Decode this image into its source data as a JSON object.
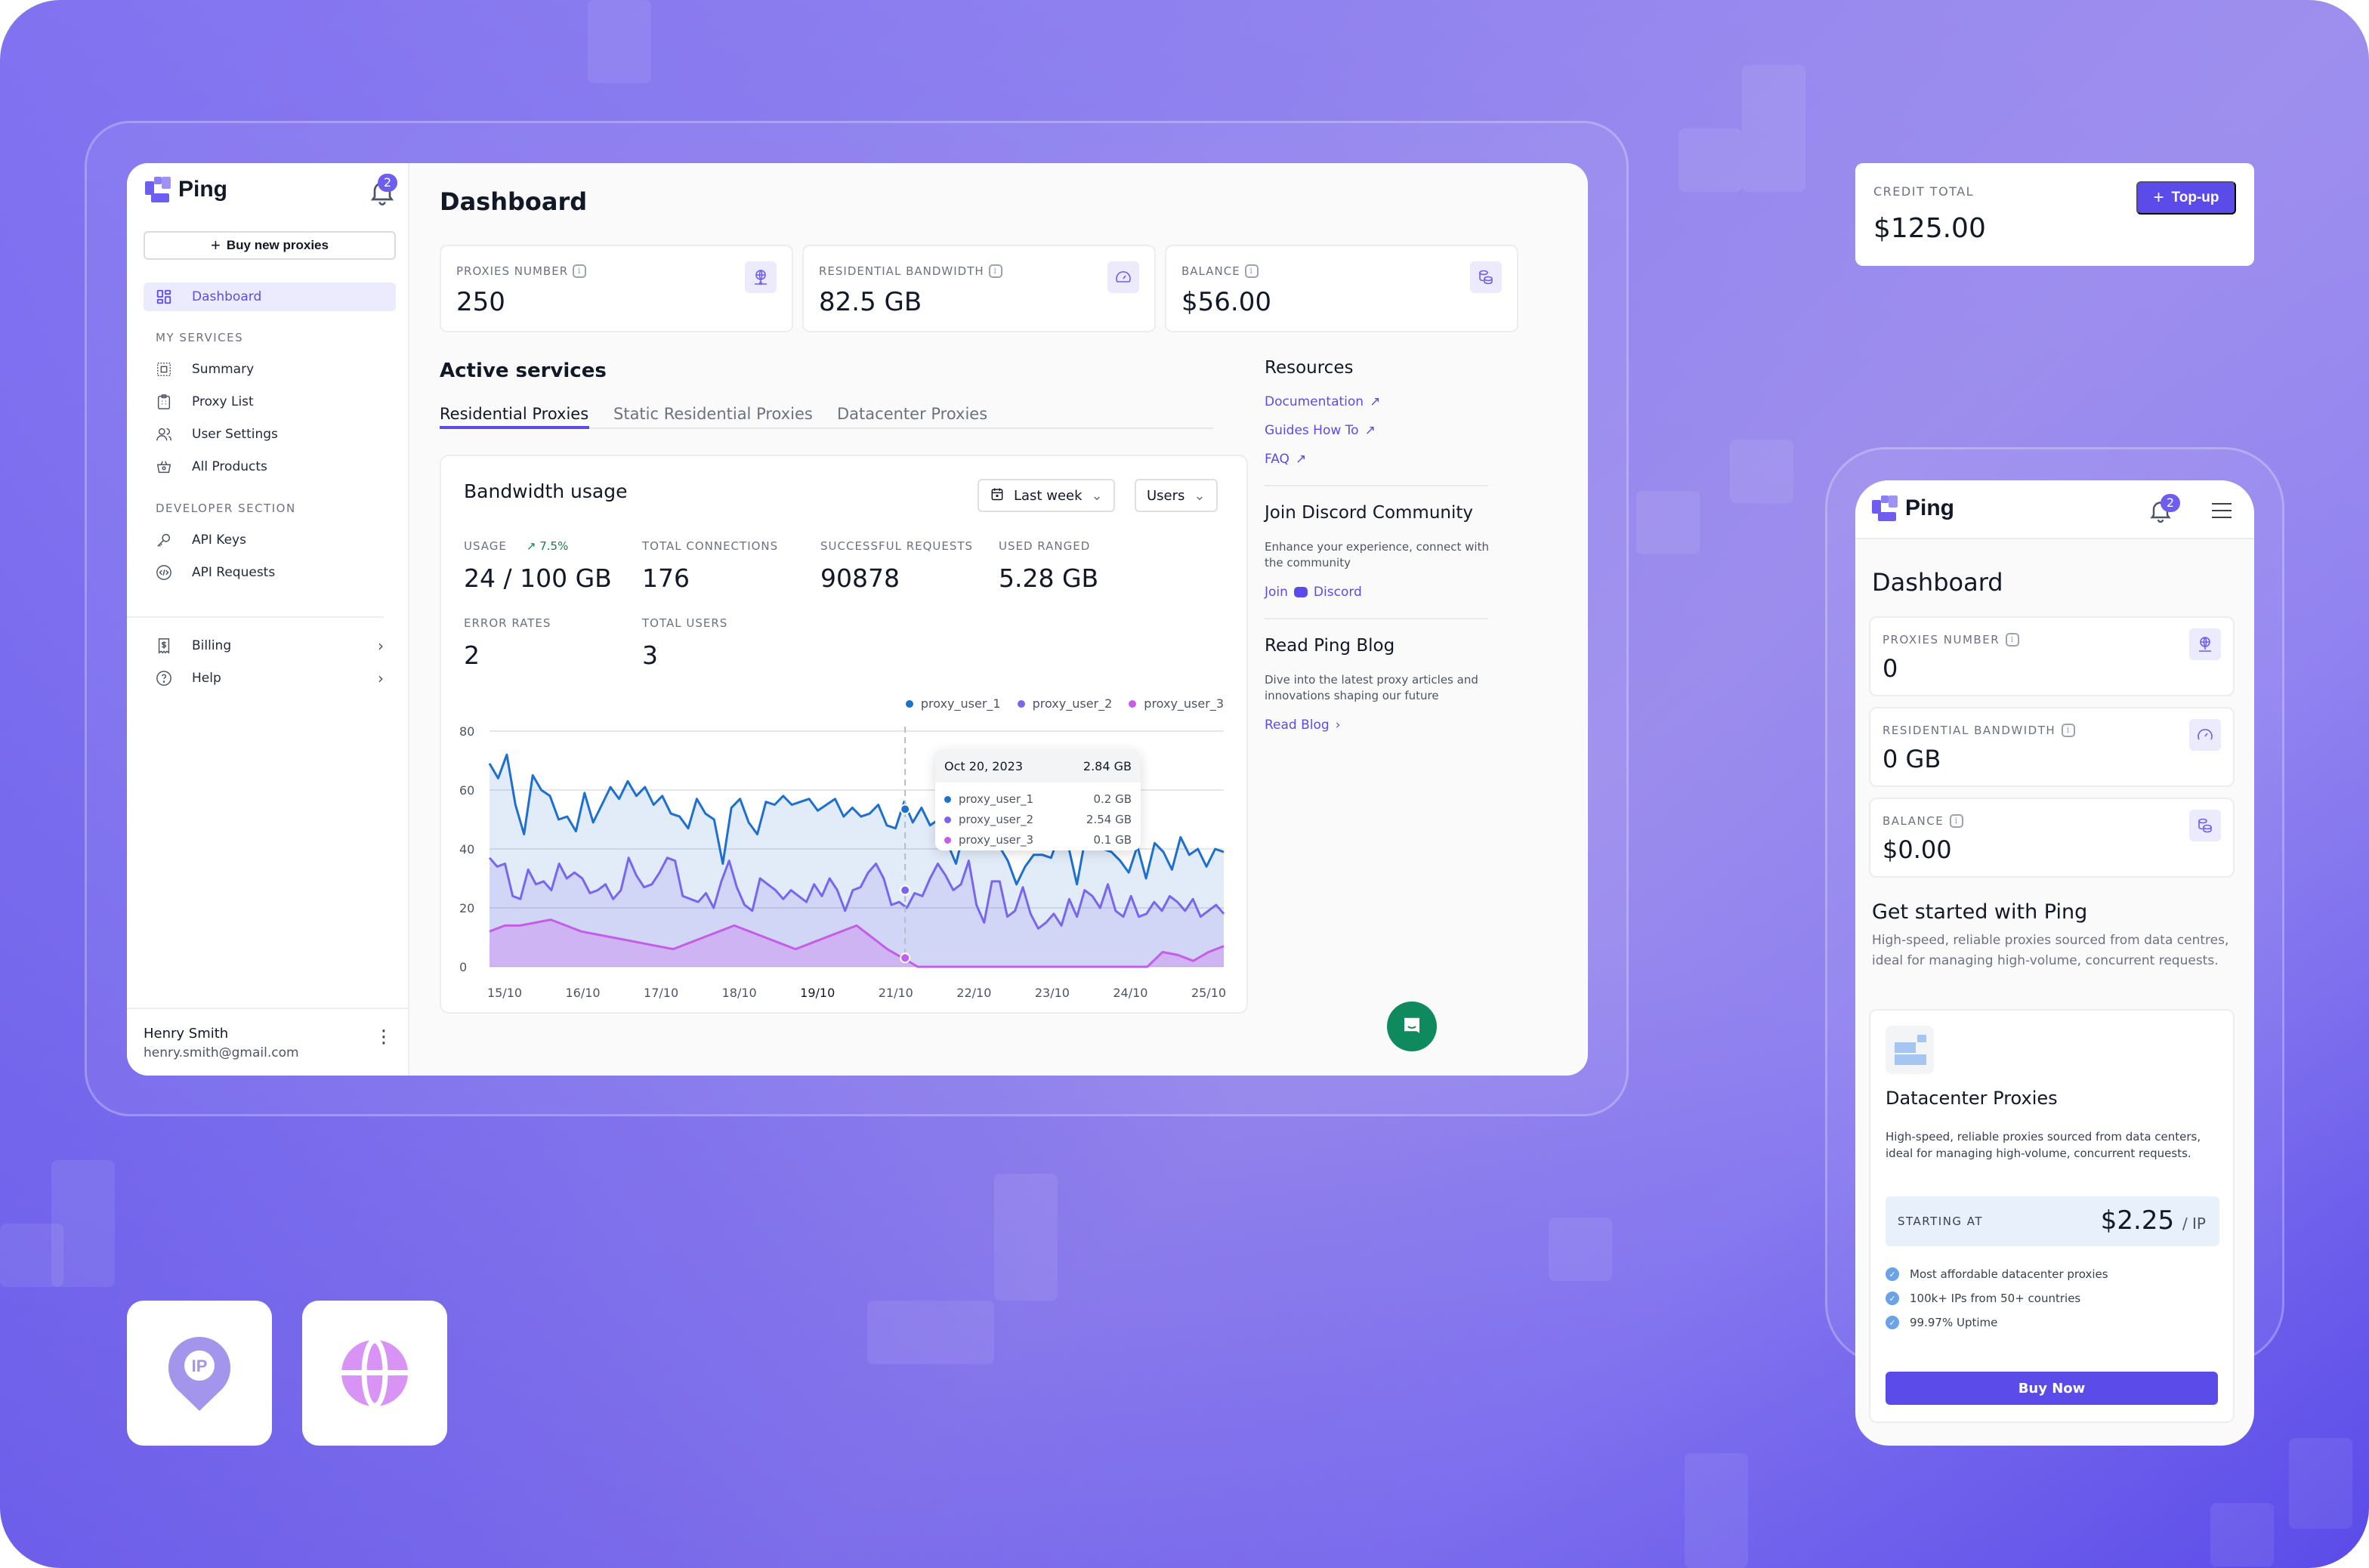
{
  "brand": {
    "name": "Ping",
    "accent": "#5b4ce9",
    "notifications": "2"
  },
  "sidebar": {
    "buy_button": "Buy new proxies",
    "items_top": [
      {
        "label": "Dashboard",
        "icon": "dashboard-grid-icon",
        "active": true
      }
    ],
    "section_services": "MY SERVICES",
    "services": [
      {
        "label": "Summary",
        "icon": "summary-icon"
      },
      {
        "label": "Proxy List",
        "icon": "clipboard-icon"
      },
      {
        "label": "User Settings",
        "icon": "users-icon"
      },
      {
        "label": "All Products",
        "icon": "basket-icon"
      }
    ],
    "section_developer": "DEVELOPER SECTION",
    "developer": [
      {
        "label": "API Keys",
        "icon": "key-icon"
      },
      {
        "label": "API Requests",
        "icon": "code-icon"
      }
    ],
    "bottom": [
      {
        "label": "Billing",
        "icon": "receipt-icon"
      },
      {
        "label": "Help",
        "icon": "help-icon"
      }
    ],
    "user": {
      "name": "Henry Smith",
      "email": "henry.smith@gmail.com"
    }
  },
  "main": {
    "title": "Dashboard",
    "stats": [
      {
        "label": "PROXIES NUMBER",
        "value": "250",
        "icon": "globe-network-icon"
      },
      {
        "label": "RESIDENTIAL BANDWIDTH",
        "value": "82.5 GB",
        "icon": "speedometer-icon"
      },
      {
        "label": "BALANCE",
        "value": "$56.00",
        "icon": "coins-icon"
      }
    ],
    "active_services": "Active services",
    "tabs": [
      {
        "label": "Residential Proxies",
        "active": true
      },
      {
        "label": "Static Residential Proxies"
      },
      {
        "label": "Datacenter Proxies"
      }
    ],
    "bandwidth": {
      "title": "Bandwidth usage",
      "period": "Last week",
      "group_by": "Users",
      "metrics": [
        {
          "label": "USAGE",
          "value": "24 / 100 GB",
          "trend": "7.5%"
        },
        {
          "label": "TOTAL CONNECTIONS",
          "value": "176"
        },
        {
          "label": "SUCCESSFUL REQUESTS",
          "value": "90878"
        },
        {
          "label": "USED RANGED",
          "value": "5.28 GB"
        },
        {
          "label": "ERROR RATES",
          "value": "2"
        },
        {
          "label": "TOTAL USERS",
          "value": "3"
        }
      ],
      "tooltip": {
        "date": "Oct 20, 2023",
        "total": "2.84 GB",
        "rows": [
          {
            "name": "proxy_user_1",
            "value": "0.2 GB"
          },
          {
            "name": "proxy_user_2",
            "value": "2.54 GB"
          },
          {
            "name": "proxy_user_3",
            "value": "0.1 GB"
          }
        ]
      }
    }
  },
  "chart_data": {
    "type": "area",
    "title": "Bandwidth usage",
    "xlabel": "",
    "ylabel": "",
    "ylim": [
      0,
      80
    ],
    "yticks": [
      0,
      20,
      40,
      60,
      80
    ],
    "categories": [
      "15/10",
      "16/10",
      "17/10",
      "18/10",
      "19/10",
      "21/10",
      "22/10",
      "23/10",
      "24/10",
      "25/10"
    ],
    "legend": "top-right",
    "grid": true,
    "series": [
      {
        "name": "proxy_user_1",
        "color": "#1d6fd0",
        "values": [
          69,
          64,
          72,
          55,
          45,
          65,
          60,
          58,
          50,
          51,
          46,
          59,
          49,
          55,
          61,
          57,
          63,
          58,
          61,
          55,
          58,
          52,
          51,
          47,
          57,
          52,
          50,
          35,
          54,
          57,
          49,
          45,
          56,
          55,
          58,
          55,
          56,
          57,
          53,
          55,
          57,
          51,
          54,
          51,
          52,
          55,
          48,
          47,
          56,
          49,
          54,
          48,
          50,
          42,
          35,
          47,
          52,
          52,
          51,
          41,
          36,
          28,
          34,
          38,
          38,
          37,
          45,
          41,
          28,
          44,
          42,
          40,
          39,
          36,
          32,
          41,
          30,
          42,
          39,
          33,
          44,
          38,
          40,
          34,
          40,
          39
        ]
      },
      {
        "name": "proxy_user_2",
        "color": "#7a66ee",
        "values": [
          37,
          34,
          35,
          24,
          23,
          33,
          28,
          29,
          26,
          35,
          30,
          32,
          30,
          25,
          26,
          28,
          23,
          26,
          37,
          31,
          27,
          28,
          32,
          37,
          36,
          24,
          23,
          22,
          25,
          20,
          29,
          36,
          27,
          21,
          19,
          30,
          28,
          26,
          23,
          26,
          24,
          22,
          28,
          24,
          30,
          26,
          19,
          26,
          27,
          32,
          35,
          30,
          21,
          22,
          20,
          25,
          24,
          30,
          35,
          31,
          26,
          28,
          36,
          21,
          15,
          29,
          29,
          17,
          19,
          27,
          18,
          13,
          15,
          18,
          14,
          23,
          17,
          26,
          24,
          20,
          28,
          19,
          17,
          24,
          17,
          18,
          22,
          19,
          24,
          22,
          19,
          23,
          17,
          19,
          21,
          18
        ]
      },
      {
        "name": "proxy_user_3",
        "color": "#c45ee8",
        "values": [
          12,
          14,
          14,
          15,
          16,
          14,
          12,
          11,
          10,
          9,
          8,
          7,
          6,
          8,
          10,
          12,
          14,
          12,
          10,
          8,
          6,
          8,
          10,
          12,
          14,
          10,
          6,
          3,
          0,
          0,
          0,
          0,
          0,
          0,
          0,
          0,
          0,
          0,
          0,
          0,
          0,
          0,
          0,
          0,
          5,
          4,
          2,
          5,
          7
        ]
      }
    ],
    "tooltip_x": "Oct 20, 2023"
  },
  "resources": {
    "title": "Resources",
    "links": [
      "Documentation",
      "Guides How To",
      "FAQ"
    ],
    "discord": {
      "title": "Join Discord Community",
      "text": "Enhance your experience, connect with the community",
      "join": "Join",
      "link": "Discord"
    },
    "blog": {
      "title": "Read Ping Blog",
      "text": "Dive into the latest proxy articles and innovations shaping our future",
      "link": "Read Blog"
    }
  },
  "credit": {
    "label": "CREDIT TOTAL",
    "value": "$125.00",
    "button": "Top-up"
  },
  "mobile": {
    "title": "Dashboard",
    "stats": [
      {
        "label": "PROXIES NUMBER",
        "value": "0"
      },
      {
        "label": "RESIDENTIAL BANDWIDTH",
        "value": "0 GB"
      },
      {
        "label": "BALANCE",
        "value": "$0.00"
      }
    ],
    "get_started": {
      "title": "Get started with Ping",
      "text": "High-speed, reliable proxies sourced from data centres, ideal for managing high-volume, concurrent requests."
    },
    "product": {
      "name": "Datacenter Proxies",
      "text": "High-speed, reliable proxies sourced from data centers, ideal for managing high-volume, concurrent requests.",
      "starting_label": "STARTING AT",
      "price": "$2.25",
      "unit": "/ IP",
      "features": [
        "Most affordable datacenter proxies",
        "100k+ IPs from 50+ countries",
        "99.97% Uptime"
      ],
      "button": "Buy Now"
    }
  },
  "tiles": [
    {
      "icon": "ip-location-pin-icon",
      "label": "IP"
    },
    {
      "icon": "globe-icon"
    }
  ]
}
